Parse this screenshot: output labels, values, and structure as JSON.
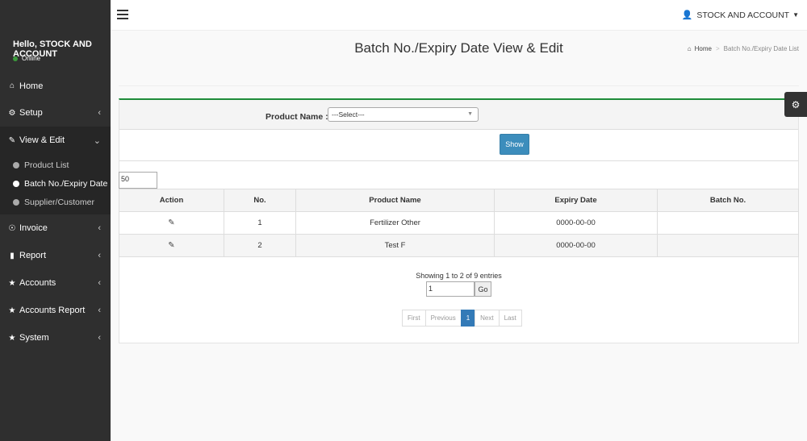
{
  "sidebar": {
    "greeting": "Hello, STOCK AND ACCOUNT",
    "status": "Online",
    "items": [
      {
        "label": "Home",
        "icon": "home-icon"
      },
      {
        "label": "Setup",
        "icon": "cogs-icon"
      },
      {
        "label": "View & Edit",
        "icon": "edit-icon"
      },
      {
        "label": "Invoice",
        "icon": "invoice-icon"
      },
      {
        "label": "Report",
        "icon": "file-icon"
      },
      {
        "label": "Accounts",
        "icon": "star-icon"
      },
      {
        "label": "Accounts Report",
        "icon": "star-icon"
      },
      {
        "label": "System",
        "icon": "star-icon"
      }
    ],
    "submenu": [
      "Product List",
      "Batch No./Expiry Date",
      "Supplier/Customer"
    ]
  },
  "navbar": {
    "user": "STOCK AND ACCOUNT"
  },
  "page": {
    "title": "Batch No./Expiry Date View & Edit",
    "breadcrumb_home": "Home",
    "breadcrumb_current": "Batch No./Expiry Date List"
  },
  "filter": {
    "label": "Product Name :",
    "select_value": "---Select---",
    "show_label": "Show"
  },
  "perpage": "50",
  "table": {
    "headers": [
      "Action",
      "No.",
      "Product Name",
      "Expiry Date",
      "Batch No."
    ],
    "rows": [
      {
        "no": "1",
        "product": "Fertilizer Other",
        "expiry": "0000-00-00",
        "batch": ""
      },
      {
        "no": "2",
        "product": "Test F",
        "expiry": "0000-00-00",
        "batch": ""
      }
    ]
  },
  "info": "Showing 1 to 2 of 9 entries",
  "goto": {
    "value": "1",
    "button": "Go"
  },
  "pager": [
    "First",
    "Previous",
    "1",
    "Next",
    "Last"
  ],
  "colors": {
    "accent": "#3c8dbc",
    "box_top": "#1f8c3a",
    "sidebar": "#2f2f2f"
  }
}
